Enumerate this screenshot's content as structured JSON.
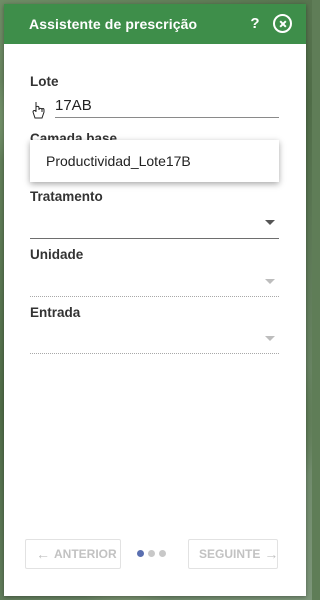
{
  "header": {
    "title": "Assistente de prescrição",
    "help_label": "?"
  },
  "form": {
    "lote_label": "Lote",
    "lote_value": "17AB",
    "camada_label": "Camada base",
    "camada_dropdown_option": "Productividad_Lote17B",
    "tratamento_label": "Tratamento",
    "unidade_label": "Unidade",
    "entrada_label": "Entrada"
  },
  "footer": {
    "prev_label": "ANTERIOR",
    "next_label": "SEGUINTE",
    "current_step": 1,
    "total_steps": 3
  },
  "colors": {
    "header": "#3e8e4a",
    "active_dot": "#5a6fb0"
  }
}
